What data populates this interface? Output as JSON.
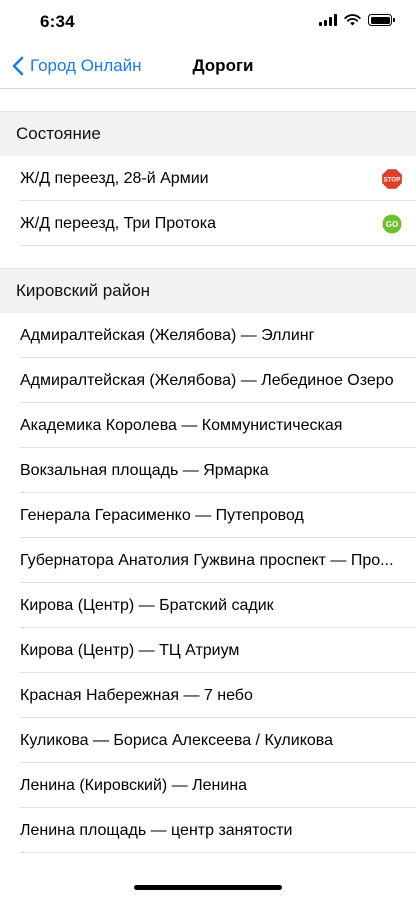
{
  "status_bar": {
    "time": "6:34"
  },
  "nav": {
    "back_label": "Город Онлайн",
    "title": "Дороги"
  },
  "sections": [
    {
      "header": "Состояние",
      "rows": [
        {
          "label": "Ж/Д переезд, 28-й Армии",
          "badge": "STOP",
          "badge_color": "#e0402a"
        },
        {
          "label": "Ж/Д переезд, Три Протока",
          "badge": "GO",
          "badge_color": "#6cbf2f"
        }
      ]
    },
    {
      "header": "Кировский район",
      "rows": [
        {
          "label": "Адмиралтейская (Желябова) — Эллинг"
        },
        {
          "label": "Адмиралтейская (Желябова) — Лебединое Озеро"
        },
        {
          "label": "Академика Королева — Коммунистическая"
        },
        {
          "label": "Вокзальная площадь — Ярмарка"
        },
        {
          "label": "Генерала Герасименко — Путепровод"
        },
        {
          "label": "Губернатора Анатолия Гужвина проспект — Про..."
        },
        {
          "label": "Кирова (Центр) — Братский садик"
        },
        {
          "label": "Кирова (Центр) — ТЦ Атриум"
        },
        {
          "label": "Красная Набережная — 7 небо"
        },
        {
          "label": "Куликова — Бориса Алексеева / Куликова"
        },
        {
          "label": "Ленина (Кировский) — Ленина"
        },
        {
          "label": "Ленина площадь — центр занятости"
        }
      ]
    }
  ]
}
